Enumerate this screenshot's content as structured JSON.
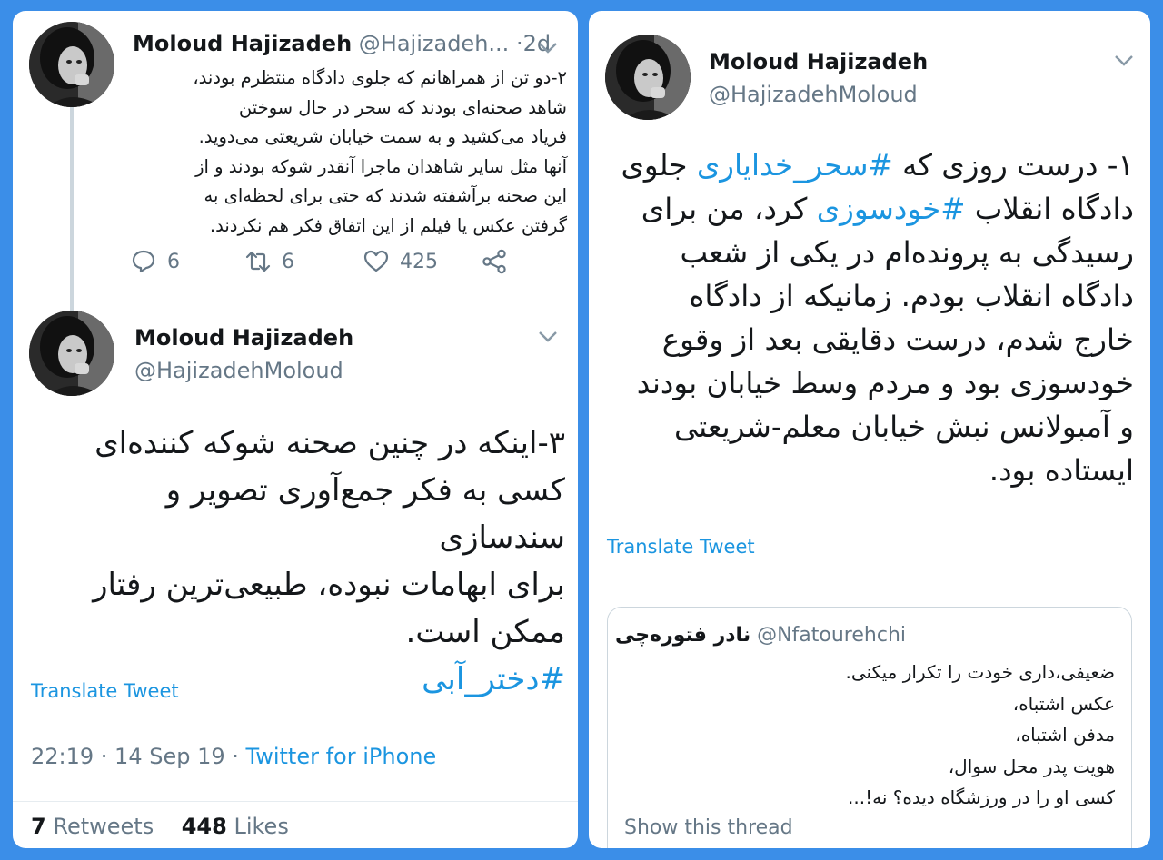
{
  "left": {
    "tweet2": {
      "author_name": "Moloud Hajizadeh",
      "author_handle": "@Hajizadeh...",
      "separator": "·",
      "time": "2d",
      "text_lines": [
        "۲-دو تن از همراهانم که جلوی دادگاه منتظرم بودند،",
        "شاهد صحنه‌ای بودند که سحر در حال سوختن",
        "فریاد می‌کشید و به سمت خیابان شریعتی می‌دوید.",
        "آنها مثل سایر شاهدان ماجرا آنقدر شوکه بودند و از",
        "این صحنه برآشفته شدند که حتی برای لحظه‌ای به",
        "گرفتن عکس یا فیلم از این اتفاق فکر هم نکردند."
      ],
      "reply_count": "6",
      "retweet_count": "6",
      "like_count": "425"
    },
    "tweet3": {
      "author_name": "Moloud Hajizadeh",
      "author_handle": "@HajizadehMoloud",
      "text_lines": [
        "۳-اینکه در چنین صحنه شوکه کننده‌ای",
        "کسی به فکر جمع‌آوری تصویر و سندسازی",
        "برای ابهامات نبوده، طبیعی‌ترین رفتار",
        "ممکن است."
      ],
      "hashtag": "#دختر_آبی",
      "translate_label": "Translate Tweet",
      "time": "22:19 · 14 Sep 19",
      "meta_separator": " · ",
      "source": "Twitter for iPhone",
      "retweets_count": "7",
      "retweets_label": "Retweets",
      "likes_count": "448",
      "likes_label": "Likes"
    }
  },
  "right": {
    "tweet1": {
      "author_name": "Moloud Hajizadeh",
      "author_handle": "@HajizadehMoloud",
      "line1_prefix": "۱- درست روزی که ",
      "line1_hashtag": "#سحر_خدایاری",
      "line1_suffix": " جلوی",
      "line2_prefix": "دادگاه انقلاب ",
      "line2_hashtag": "#خودسوزی",
      "line2_suffix": " کرد، من برای",
      "text_lines_rest": [
        "رسیدگی به پرونده‌ام در یکی از شعب",
        "دادگاه انقلاب بودم. زمانیکه از دادگاه",
        "خارج شدم، درست دقایقی بعد از وقوع",
        "خودسوزی بود و مردم وسط خیابان بودند",
        "و آمبولانس نبش خیابان معلم-شریعتی",
        "ایستاده بود."
      ],
      "translate_label": "Translate Tweet"
    },
    "quote": {
      "author_name": "نادر فتوره‌چی",
      "author_handle": "@Nfatourehchi",
      "text_lines": [
        "ضعیفی،داری خودت را تکرار میکنی.",
        "عکس اشتباه،",
        "مدفن اشتباه،",
        "هویت پدر محل سوال،",
        "کسی او را در ورزشگاه دیده؟ نه!..."
      ],
      "show_thread_label": "Show this thread"
    }
  },
  "icons": {
    "reply": "reply-icon",
    "retweet": "retweet-icon",
    "like": "heart-icon",
    "share": "share-icon",
    "more": "chevron-down-icon"
  },
  "colors": {
    "background": "#3b8ee8",
    "link": "#1b95e0",
    "muted": "#657786",
    "text": "#14171a"
  }
}
